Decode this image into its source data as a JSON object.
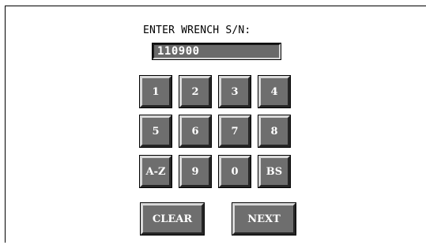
{
  "prompt": {
    "label": "ENTER WRENCH S/N:"
  },
  "serial_input": {
    "value": "110900"
  },
  "keypad": {
    "row1": [
      "1",
      "2",
      "3",
      "4"
    ],
    "row2": [
      "5",
      "6",
      "7",
      "8"
    ],
    "row3": [
      "A-Z",
      "9",
      "0",
      "BS"
    ]
  },
  "actions": {
    "clear_label": "CLEAR",
    "next_label": "NEXT"
  }
}
